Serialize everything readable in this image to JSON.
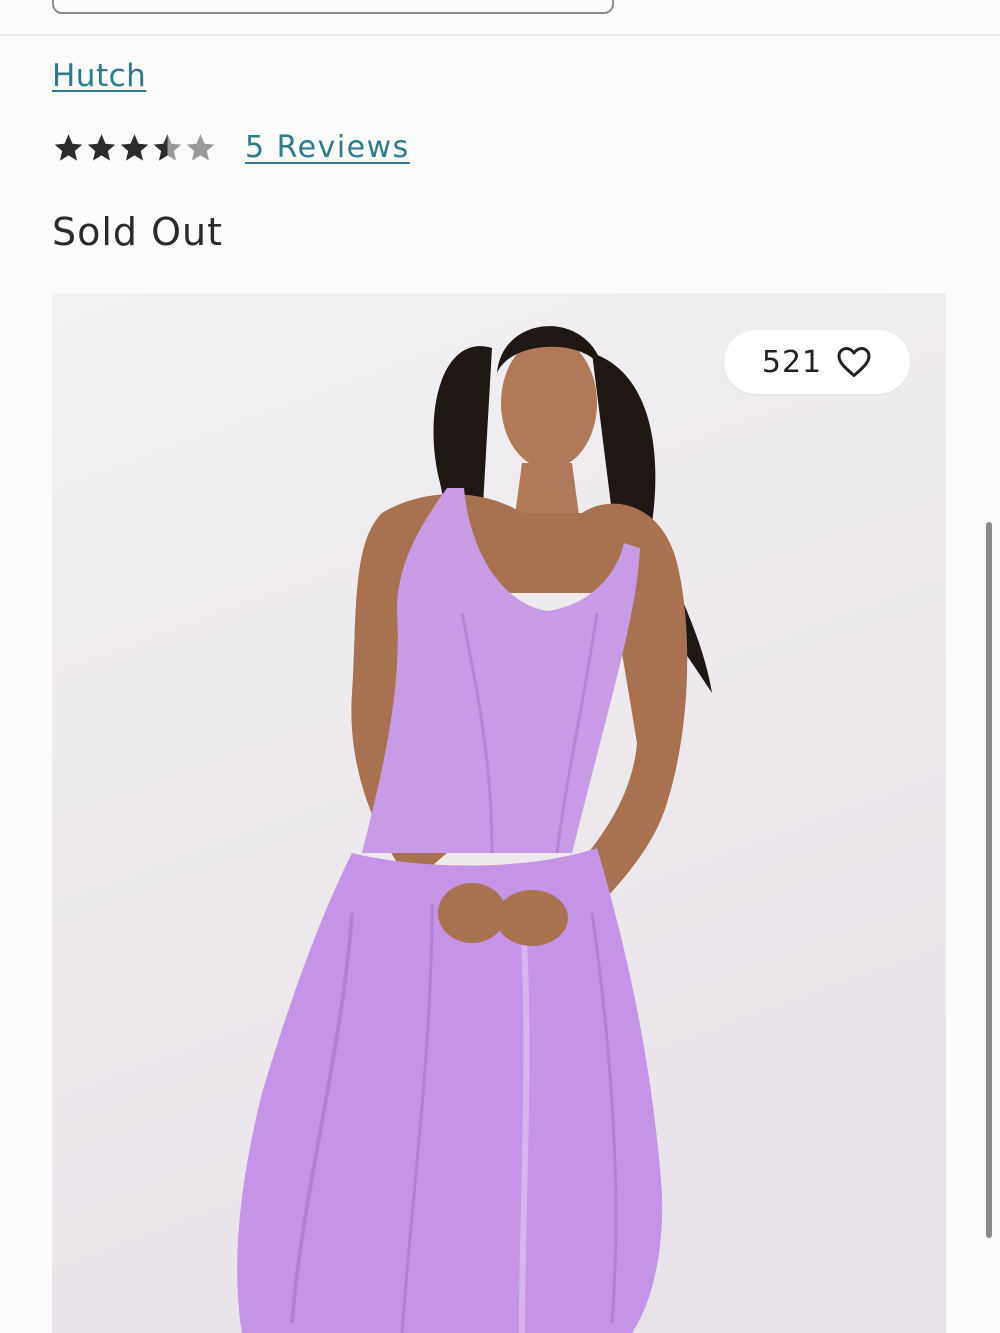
{
  "product": {
    "brand": "Hutch",
    "rating": 3.5,
    "rating_max": 5,
    "reviews_label": "5 Reviews",
    "availability": "Sold Out"
  },
  "image": {
    "description_icon": "product-photo",
    "like_count": "521"
  },
  "colors": {
    "link": "#2d7b8c",
    "star_filled": "#2b2b2b",
    "star_empty": "#9a9a9a",
    "dress": "#c79be6"
  }
}
